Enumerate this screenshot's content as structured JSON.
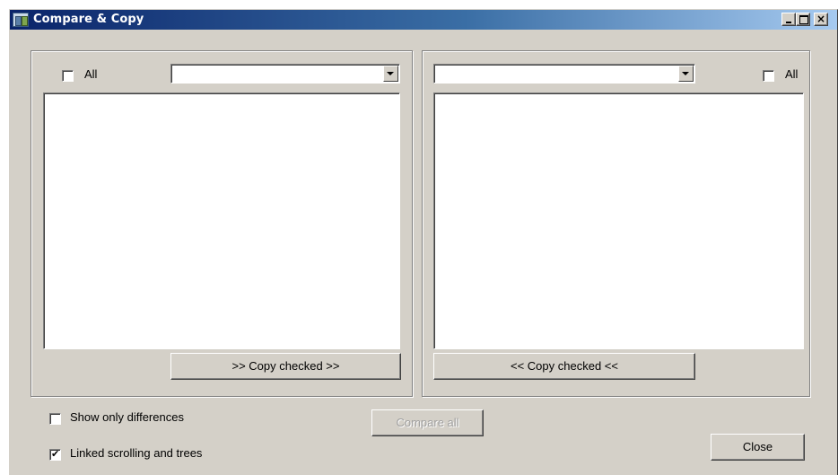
{
  "window": {
    "title": "Compare & Copy"
  },
  "titlebar_buttons": {
    "minimize": "_",
    "maximize": "□",
    "close": "×"
  },
  "left_panel": {
    "all_checkbox": {
      "label": "All",
      "checked": false
    },
    "combo_value": "",
    "copy_button": ">> Copy checked >>"
  },
  "right_panel": {
    "all_checkbox": {
      "label": "All",
      "checked": false
    },
    "combo_value": "",
    "copy_button": "<< Copy checked <<"
  },
  "options": {
    "show_only_differences": {
      "label": "Show only differences",
      "checked": false
    },
    "linked_scrolling": {
      "label": "Linked scrolling and trees",
      "checked": true
    }
  },
  "buttons": {
    "compare_all": "Compare all",
    "close": "Close"
  }
}
